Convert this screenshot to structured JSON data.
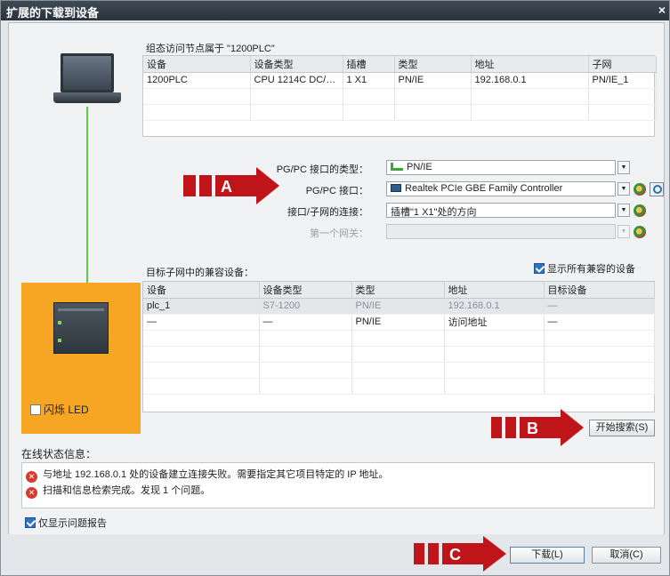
{
  "window": {
    "title": "扩展的下载到设备",
    "close_glyph": "×"
  },
  "access_node": {
    "caption": "组态访问节点属于 \"1200PLC\"",
    "columns": [
      "设备",
      "设备类型",
      "插槽",
      "类型",
      "地址",
      "子网"
    ],
    "rows": [
      [
        "1200PLC",
        "CPU 1214C DC/D...",
        "1 X1",
        "PN/IE",
        "192.168.0.1",
        "PN/IE_1"
      ]
    ]
  },
  "form": {
    "pgpc_type_label": "PG/PC 接口的类型：",
    "pgpc_type_value": "PN/IE",
    "pgpc_if_label": "PG/PC 接口：",
    "pgpc_if_value": "Realtek PCIe GBE Family Controller",
    "subnet_conn_label": "接口/子网的连接：",
    "subnet_conn_value": "插槽\"1 X1\"处的方向",
    "gateway_label": "第一个网关：",
    "gateway_value": ""
  },
  "markers": {
    "a": "A",
    "b": "B",
    "c": "C"
  },
  "compat": {
    "caption": "目标子网中的兼容设备：",
    "show_all_label": "显示所有兼容的设备",
    "columns": [
      "设备",
      "设备类型",
      "类型",
      "地址",
      "目标设备"
    ],
    "rows": [
      [
        "plc_1",
        "S7-1200",
        "PN/IE",
        "192.168.0.1",
        "—"
      ],
      [
        "—",
        "—",
        "PN/IE",
        "访问地址",
        "—"
      ]
    ]
  },
  "device_panel": {
    "flash_led_label": "闪烁 LED"
  },
  "buttons": {
    "start_search": "开始搜索(S)",
    "download": "下载(L)",
    "cancel": "取消(C)"
  },
  "status": {
    "caption": "在线状态信息：",
    "messages": [
      "与地址 192.168.0.1 处的设备建立连接失败。需要指定其它项目特定的 IP 地址。",
      "扫描和信息检索完成。发现 1 个问题。"
    ],
    "error_glyph": "✕",
    "only_problems_label": "仅显示问题报告"
  },
  "colors": {
    "marker_red": "#c0141b",
    "device_panel": "#f6a623",
    "link_green": "#59d23a"
  }
}
